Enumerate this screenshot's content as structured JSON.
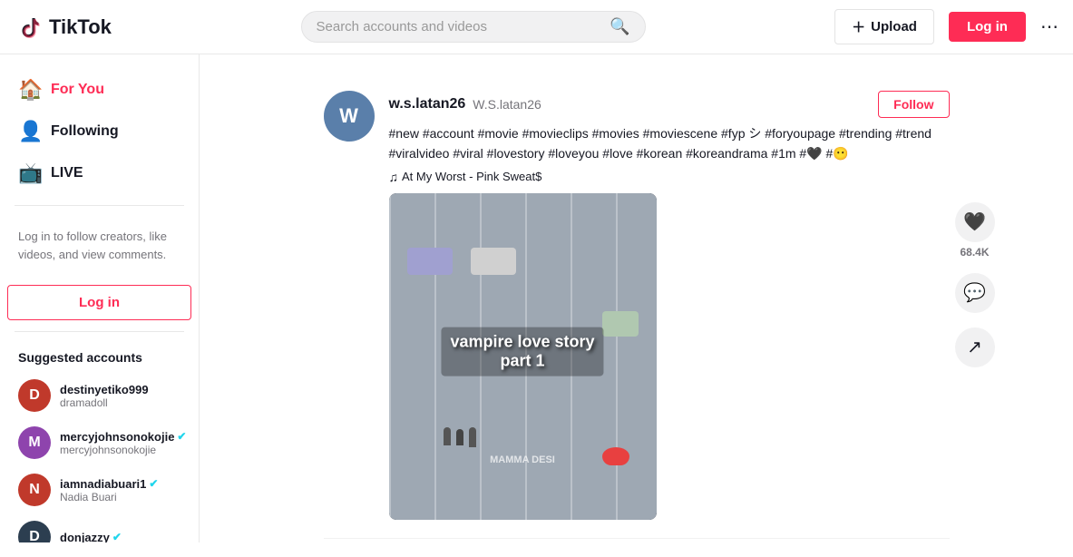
{
  "header": {
    "logo_text": "TikTok",
    "search_placeholder": "Search accounts and videos",
    "upload_label": "Upload",
    "login_label": "Log in",
    "more_icon": "⋯"
  },
  "sidebar": {
    "nav_items": [
      {
        "id": "for-you",
        "label": "For You",
        "icon": "🏠",
        "active": true
      },
      {
        "id": "following",
        "label": "Following",
        "icon": "👤",
        "active": false
      },
      {
        "id": "live",
        "label": "LIVE",
        "icon": "📺",
        "active": false
      }
    ],
    "login_prompt": "Log in to follow creators, like videos, and view comments.",
    "login_btn_label": "Log in",
    "suggested_label": "Suggested accounts",
    "accounts": [
      {
        "id": "destinyetiko999",
        "username": "destinyetiko999",
        "display": "dramadoll",
        "verified": false,
        "color": "#c0392b",
        "letter": "D"
      },
      {
        "id": "mercyjohnsonokojie",
        "username": "mercyjohnsonokojie",
        "display": "mercyjohnsonokojie",
        "verified": true,
        "color": "#8e44ad",
        "letter": "M"
      },
      {
        "id": "iamnadiabuari1",
        "username": "iamnadiabuari1",
        "display": "Nadia Buari",
        "verified": true,
        "color": "#c0392b",
        "letter": "N"
      },
      {
        "id": "donjazzy",
        "username": "donjazzy",
        "display": "",
        "verified": true,
        "color": "#2c3e50",
        "letter": "D"
      }
    ]
  },
  "feed": {
    "posts": [
      {
        "id": "post1",
        "author_username": "w.s.latan26",
        "author_display": "W.S.latan26",
        "description": "#new #account #movie #movieclips #movies #moviescene #fyp シ #foryoupage #trending #trend #viralvideo #viral #lovestory #loveyou #love #korean #koreandrama #1m #🖤 #😶",
        "music": "At My Worst - Pink Sweat$",
        "follow_label": "Follow",
        "overlay_text": "vampire love story\npart 1",
        "watermark": "MAMMA DESI",
        "likes": "68.4K",
        "avatar_color": "#5a7faa",
        "avatar_letter": "W"
      }
    ]
  }
}
